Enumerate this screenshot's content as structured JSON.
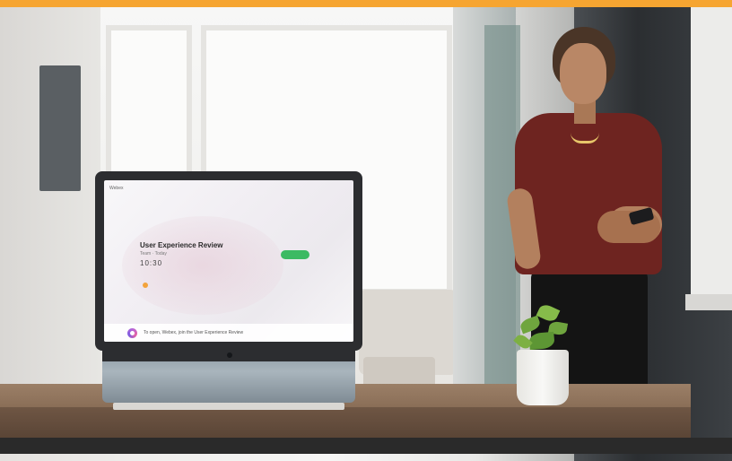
{
  "device_screen": {
    "brand": "Webex",
    "meeting_title": "User Experience Review",
    "meeting_subtitle": "Team · Today",
    "meeting_time": "10:30",
    "assistant_prompt": "To open, Webex, join the User Experience Review"
  },
  "colors": {
    "accent_bar": "#f6a531",
    "join_button": "#3cba63"
  }
}
